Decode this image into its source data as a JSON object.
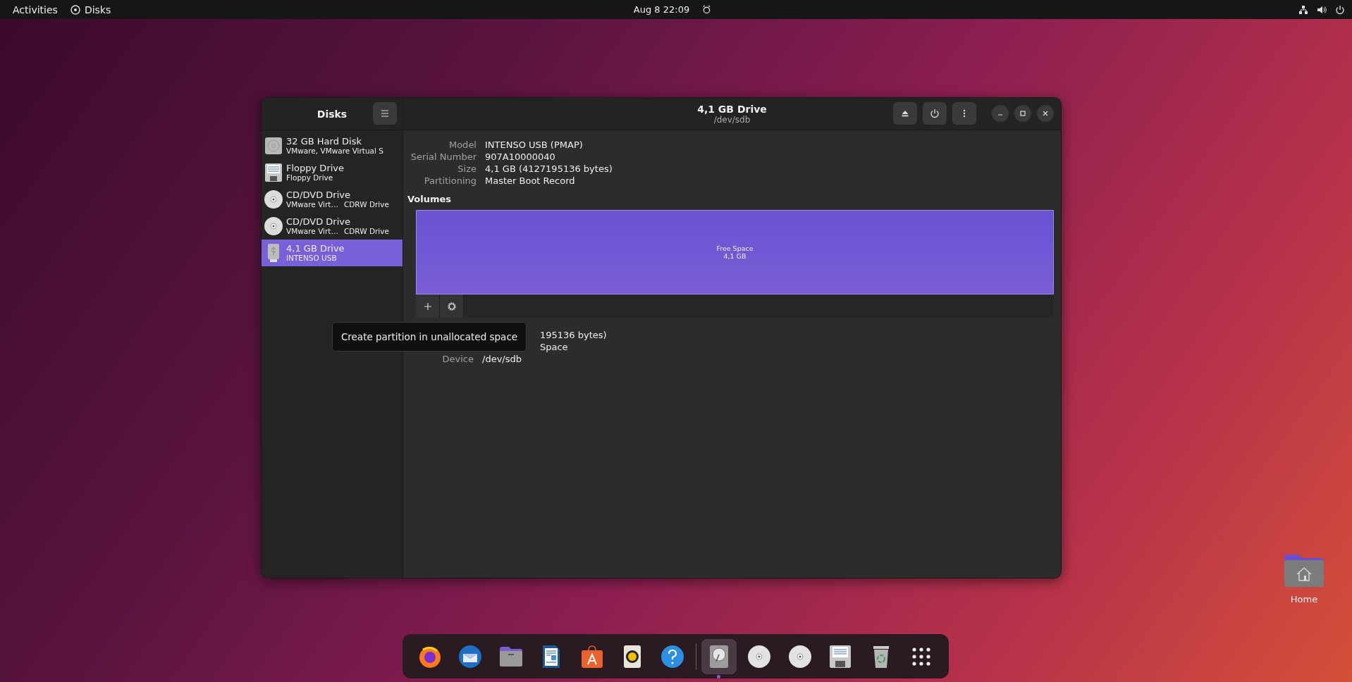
{
  "top_bar": {
    "activities": "Activities",
    "app_name": "Disks",
    "clock": "Aug 8  22:09"
  },
  "window": {
    "sidebar_title": "Disks",
    "title": "4,1 GB Drive",
    "subtitle": "/dev/sdb"
  },
  "drives": [
    {
      "kind": "harddisk",
      "name": "32 GB Hard Disk",
      "detail": "VMware, VMware Virtual S",
      "selected": false
    },
    {
      "kind": "floppy",
      "name": "Floppy Drive",
      "detail": "Floppy Drive",
      "selected": false
    },
    {
      "kind": "optical",
      "name": "CD/DVD Drive",
      "detail": "VMware Virt…",
      "detail_2": "CDRW Drive",
      "selected": false
    },
    {
      "kind": "optical",
      "name": "CD/DVD Drive",
      "detail": "VMware Virt…",
      "detail_2": "CDRW Drive",
      "selected": false
    },
    {
      "kind": "usb",
      "name": "4,1 GB Drive",
      "detail": "INTENSO USB",
      "selected": true
    }
  ],
  "drive_details": [
    {
      "label": "Model",
      "value": "INTENSO USB (PMAP)"
    },
    {
      "label": "Serial Number",
      "value": "907A10000040"
    },
    {
      "label": "Size",
      "value": "4,1 GB (4127195136 bytes)"
    },
    {
      "label": "Partitioning",
      "value": "Master Boot Record"
    }
  ],
  "volumes": {
    "heading": "Volumes",
    "segment_label": "Free Space",
    "segment_size": "4,1 GB"
  },
  "partition_details": [
    {
      "value": "195136 bytes)"
    },
    {
      "value": "Space"
    },
    {
      "label": "Device",
      "value": "/dev/sdb"
    }
  ],
  "tooltip": "Create partition in unallocated space",
  "dock": [
    {
      "kind": "firefox",
      "running": false
    },
    {
      "kind": "mail",
      "running": false
    },
    {
      "kind": "files",
      "running": false
    },
    {
      "kind": "writer",
      "running": false
    },
    {
      "kind": "store",
      "running": false
    },
    {
      "kind": "music",
      "running": false
    },
    {
      "kind": "help",
      "running": false
    },
    {
      "kind": "separator"
    },
    {
      "kind": "disks",
      "running": true
    },
    {
      "kind": "cd",
      "running": false
    },
    {
      "kind": "cd",
      "running": false
    },
    {
      "kind": "floppy",
      "running": false
    },
    {
      "kind": "trash",
      "running": false
    },
    {
      "kind": "apps",
      "running": false
    }
  ],
  "desktop_icons": [
    {
      "label": "Home"
    }
  ]
}
